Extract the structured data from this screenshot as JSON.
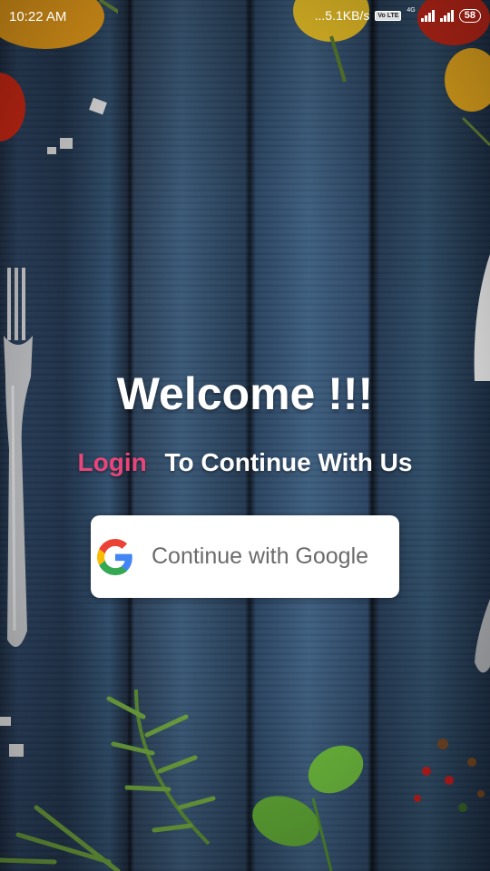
{
  "status_bar": {
    "time": "10:22 AM",
    "net_speed": "...5.1KB/s",
    "volte": "Vo LTE",
    "network_type": "4G",
    "battery": "58"
  },
  "welcome": {
    "title": "Welcome !!!",
    "login_link": "Login",
    "tagline": "To Continue With Us"
  },
  "google_button": {
    "label": "Continue with Google",
    "icon": "google-logo-icon"
  },
  "colors": {
    "login_accent": "#e8457a",
    "button_bg": "#ffffff",
    "button_text": "#6b6b6b"
  }
}
